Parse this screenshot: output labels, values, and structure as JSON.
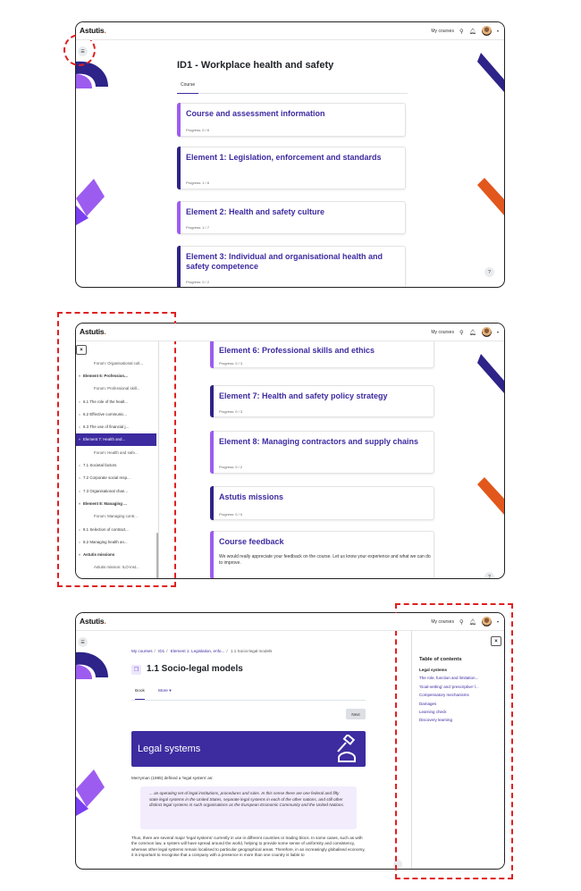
{
  "app": {
    "logo": "Astutis",
    "logo_dot": ".",
    "my_courses": "My courses"
  },
  "page1": {
    "title": "ID1 - Workplace health and safety",
    "tab": "Course",
    "cards": [
      {
        "title": "Course and assessment information",
        "progress": "Progress: 0 / 6",
        "bar": "#9d5cf0"
      },
      {
        "title": "Element 1: Legislation, enforcement and standards",
        "progress": "Progress: 1 / 6",
        "bar": "#2d2388"
      },
      {
        "title": "Element 2: Health and safety culture",
        "progress": "Progress: 1 / 7",
        "bar": "#9d5cf0"
      },
      {
        "title": "Element 3: Individual and organisational health and safety competence",
        "progress": "Progress: 0 / 2",
        "bar": "#2d2388"
      }
    ],
    "help": "?"
  },
  "page2": {
    "drawer_close": "×",
    "drawer_items": [
      {
        "mark": "",
        "label": "Forum: Organisational cult...",
        "kind": "sub"
      },
      {
        "mark": "˅",
        "label": "Element 6: Profession...",
        "kind": "sec"
      },
      {
        "mark": "",
        "label": "Forum: Professional skill...",
        "kind": "sub"
      },
      {
        "mark": "○",
        "label": "6.1 The role of the healt...",
        "kind": "item"
      },
      {
        "mark": "○",
        "label": "6.2 Effective communic...",
        "kind": "item"
      },
      {
        "mark": "○",
        "label": "6.3 The use of financial j...",
        "kind": "item"
      },
      {
        "mark": "˅",
        "label": "Element 7: Health and...",
        "kind": "act"
      },
      {
        "mark": "",
        "label": "Forum: Health and safe...",
        "kind": "sub"
      },
      {
        "mark": "○",
        "label": "7.1 Societal factors",
        "kind": "item"
      },
      {
        "mark": "○",
        "label": "7.2 Corporate social resp...",
        "kind": "item"
      },
      {
        "mark": "○",
        "label": "7.3 Organisational chan...",
        "kind": "item"
      },
      {
        "mark": "˅",
        "label": "Element 8: Managing ...",
        "kind": "sec"
      },
      {
        "mark": "",
        "label": "Forum: Managing contr...",
        "kind": "sub"
      },
      {
        "mark": "○",
        "label": "8.1 Selection of contract...",
        "kind": "item"
      },
      {
        "mark": "○",
        "label": "8.2 Managing health an...",
        "kind": "item"
      },
      {
        "mark": "˅",
        "label": "Astutis missions",
        "kind": "sec"
      },
      {
        "mark": "",
        "label": "Astutis mission: ILO-inst...",
        "kind": "sub"
      },
      {
        "mark": "",
        "label": "Astutis mission: Health ...",
        "kind": "sub"
      }
    ],
    "cards": [
      {
        "title": "Element 6: Professional skills and ethics",
        "progress": "Progress: 0 / 3",
        "bar": "#9d5cf0"
      },
      {
        "title": "Element 7: Health and safety policy strategy",
        "progress": "Progress: 0 / 3",
        "bar": "#2d2388"
      },
      {
        "title": "Element 8: Managing contractors and supply chains",
        "progress": "Progress: 0 / 2",
        "bar": "#9d5cf0"
      },
      {
        "title": "Astutis missions",
        "progress": "Progress: 0 / 0",
        "bar": "#2d2388"
      },
      {
        "title": "Course feedback",
        "desc": "We would really appreciate your feedback on the course. Let us know your experience and what we can do to improve.",
        "bar": "#9d5cf0"
      }
    ]
  },
  "page3": {
    "crumbs": [
      "My courses",
      "ID1",
      "Element 1: Legislation, enfo...",
      "1.1 Socio-legal models"
    ],
    "title": "1.1 Socio-legal models",
    "tab_book": "Book",
    "tab_more": "More ▾",
    "next": "Next",
    "banner": "Legal systems",
    "intro": "Merryman (1985) defined a 'legal system' as:",
    "quote": "... an operating set of legal institutions, procedures and rules. In this sense there are one federal and fifty state legal systems in the United States, separate legal systems in each of the other nations, and still other distinct legal systems in such organisations as the European Economic Community and the United Nations.",
    "body": "Thus, there are several major 'legal systems' currently in use in different countries or trading blocs. In some cases, such as with the common law, a system will have spread around the world, helping to provide some sense of uniformity and consistency, whereas other legal systems remain localised to particular geographical areas. Therefore, in an increasingly globalised economy, it is important to recognise that a company with a presence in more than one country is liable to",
    "toc_close": "×",
    "toc_title": "Table of contents",
    "toc": [
      "Legal systems",
      "The role, function and limitation...",
      "'Goal-setting' and 'prescriptive' l...",
      "Compensatory mechanisms",
      "Damages",
      "Learning check",
      "Discovery learning"
    ]
  },
  "colors": {
    "brand": "#3d2ba0",
    "purple": "#9d5cf0",
    "navy": "#2d2388",
    "orange": "#e2571c",
    "highlight": "#e02020"
  }
}
